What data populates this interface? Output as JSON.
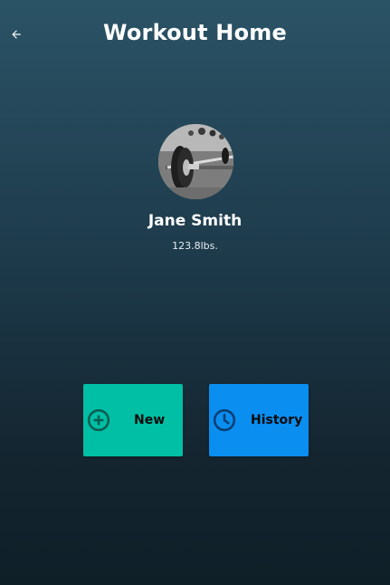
{
  "header": {
    "title": "Workout Home",
    "back_icon": "arrow-left-icon"
  },
  "profile": {
    "name": "Jane Smith",
    "weight": "123.8lbs.",
    "avatar_icon": "barbell-photo-avatar"
  },
  "actions": [
    {
      "label": "New",
      "icon": "add-circle-icon",
      "color": "#00bfa5"
    },
    {
      "label": "History",
      "icon": "history-clock-icon",
      "color": "#0a8ef0"
    }
  ],
  "colors": {
    "background_top": "#2b5366",
    "background_bottom": "#0f1f28",
    "new_tile": "#00bfa5",
    "history_tile": "#0a8ef0",
    "icon_dark": "#0b5f54"
  }
}
